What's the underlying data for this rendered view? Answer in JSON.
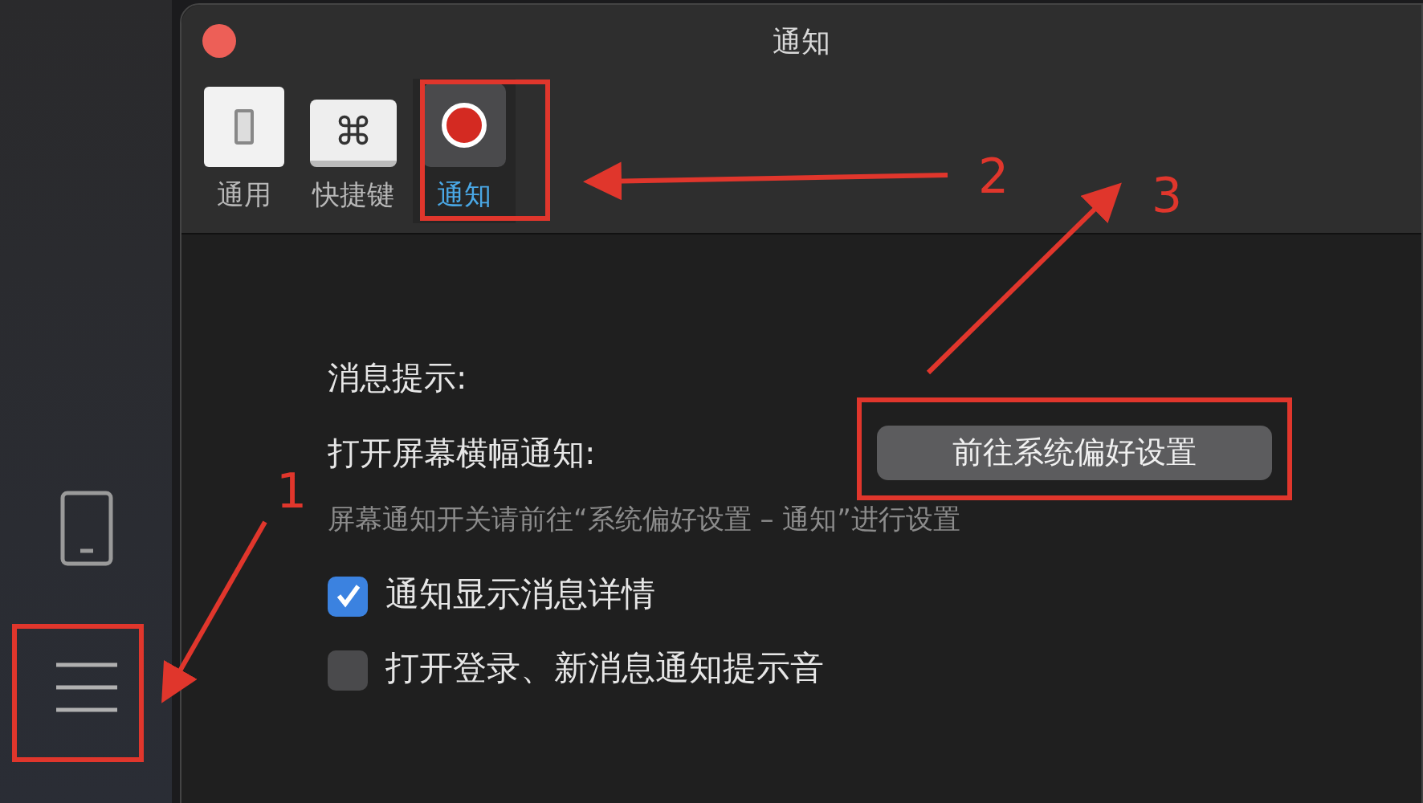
{
  "window": {
    "title": "通知"
  },
  "tabs": [
    {
      "label": "通用",
      "kind": "switch",
      "selected": false
    },
    {
      "label": "快捷键",
      "kind": "command",
      "selected": false
    },
    {
      "label": "通知",
      "kind": "record",
      "selected": true
    }
  ],
  "section_label": "消息提示:",
  "banner": {
    "label": "打开屏幕横幅通知:",
    "button": "前往系统偏好设置",
    "hint": "屏幕通知开关请前往“系统偏好设置 – 通知”进行设置"
  },
  "checkboxes": [
    {
      "label": "通知显示消息详情",
      "checked": true
    },
    {
      "label": "打开登录、新消息通知提示音",
      "checked": false
    }
  ],
  "annotations": [
    {
      "label": "1"
    },
    {
      "label": "2"
    },
    {
      "label": "3"
    }
  ]
}
